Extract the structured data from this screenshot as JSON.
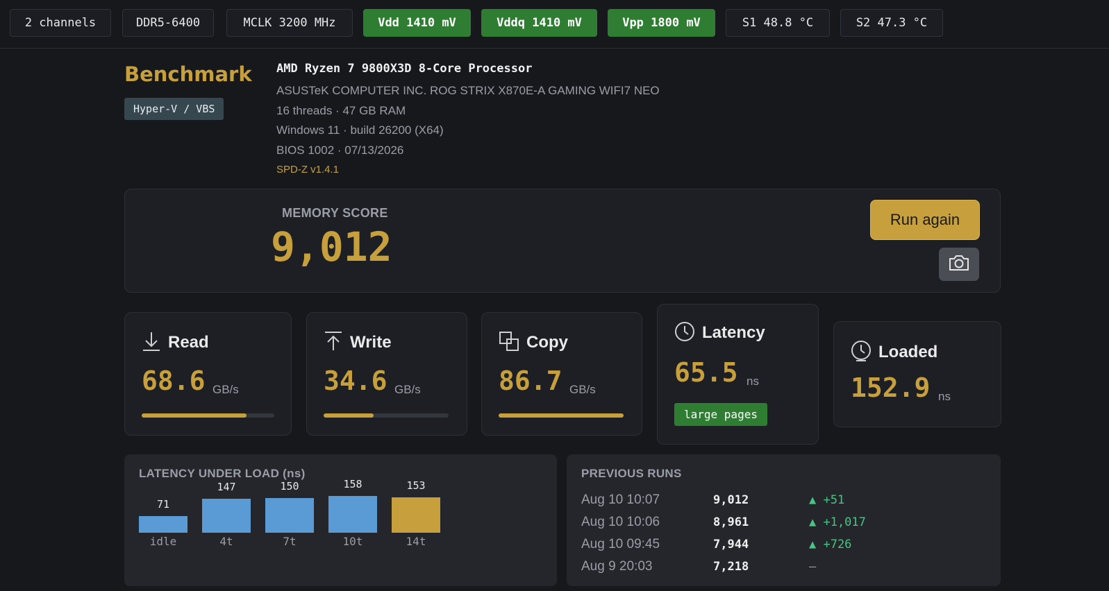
{
  "topbar": {
    "chips": [
      {
        "label": "2 channels",
        "style": "plain"
      },
      {
        "label": "DDR5-6400",
        "style": "plain"
      },
      {
        "label": "MCLK 3200 MHz",
        "style": "plain"
      },
      {
        "label": "Vdd 1410 mV",
        "style": "green"
      },
      {
        "label": "Vddq 1410 mV",
        "style": "green"
      },
      {
        "label": "Vpp 1800 mV",
        "style": "green"
      },
      {
        "label": "S1 48.8 °C",
        "style": "plain"
      },
      {
        "label": "S2 47.3 °C",
        "style": "plain"
      }
    ]
  },
  "header": {
    "title": "Benchmark",
    "badge": "Hyper-V / VBS",
    "cpu": "AMD Ryzen 7 9800X3D 8-Core Processor",
    "board": "ASUSTeK COMPUTER INC. ROG STRIX X870E-A GAMING WIFI7 NEO",
    "threads": "16 threads · 47 GB RAM",
    "os": "Windows 11 · build 26200 (X64)",
    "bios": "BIOS 1002 · 07/13/2026",
    "version": "SPD-Z v1.4.1"
  },
  "score": {
    "label": "MEMORY SCORE",
    "value": "9,012",
    "run_button": "Run again",
    "screenshot_icon": "camera-icon"
  },
  "metrics": {
    "read": {
      "title": "Read",
      "value": "68.6",
      "unit": "GB/s",
      "bar_fraction": 0.79,
      "icon": "download-icon"
    },
    "write": {
      "title": "Write",
      "value": "34.6",
      "unit": "GB/s",
      "bar_fraction": 0.4,
      "icon": "upload-icon"
    },
    "copy": {
      "title": "Copy",
      "value": "86.7",
      "unit": "GB/s",
      "bar_fraction": 1.0,
      "icon": "copy-icon"
    },
    "latency": {
      "title": "Latency",
      "value": "65.5",
      "unit": "ns",
      "badge": "large pages",
      "icon": "clock-icon"
    },
    "loaded": {
      "title": "Loaded",
      "value": "152.9",
      "unit": "ns",
      "icon": "timer-icon"
    }
  },
  "latency_chart": {
    "title": "LATENCY UNDER LOAD (ns)"
  },
  "chart_data": {
    "type": "bar",
    "categories": [
      "idle",
      "4t",
      "7t",
      "10t",
      "14t"
    ],
    "values": [
      71,
      147,
      150,
      158,
      153
    ],
    "highlight_index": 4,
    "colors": {
      "default": "#5b9bd5",
      "highlight": "#c7a03d"
    }
  },
  "previous_runs": {
    "title": "PREVIOUS RUNS",
    "rows": [
      {
        "date": "Aug 10 10:07",
        "score": "9,012",
        "delta": "▲ +51",
        "trend": "up"
      },
      {
        "date": "Aug 10 10:06",
        "score": "8,961",
        "delta": "▲ +1,017",
        "trend": "up"
      },
      {
        "date": "Aug 10 09:45",
        "score": "7,944",
        "delta": "▲ +726",
        "trend": "up"
      },
      {
        "date": "Aug 9 20:03",
        "score": "7,218",
        "delta": "–",
        "trend": "none"
      }
    ]
  },
  "colors": {
    "accent": "#c7a03d",
    "green": "#2e7d32",
    "delta_up": "#4cc285",
    "bar_blue": "#5b9bd5"
  }
}
